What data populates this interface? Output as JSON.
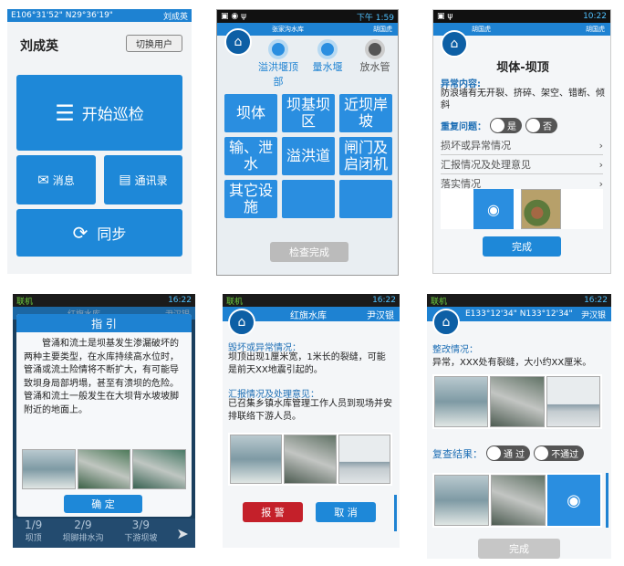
{
  "p1": {
    "status_coords": "E106°31'52\" N29°36'19\"",
    "status_user": "刘成英",
    "user_name": "刘成英",
    "switch_user": "切换用户",
    "start_inspection": "开始巡检",
    "messages": "消息",
    "contacts": "通讯录",
    "sync": "同步"
  },
  "p2": {
    "status_time": "下午 1:59",
    "title": "张家沟水库",
    "user": "胡国虎",
    "tabs": [
      {
        "label": "溢洪堰顶部"
      },
      {
        "label": "量水堰"
      },
      {
        "label": "放水管"
      }
    ],
    "tiles": [
      "坝体",
      "坝基坝区",
      "近坝岸坡",
      "输、泄水",
      "溢洪道",
      "闸门及启闭机",
      "其它设施",
      "",
      ""
    ],
    "check_done": "检查完成"
  },
  "p3": {
    "status_time": "10:22",
    "title": "胡国虎",
    "user": "胡国虎",
    "page_title": "坝体-坝顶",
    "abnormal_label": "异常内容:",
    "abnormal_text": "防浪墙有无开裂、挤碎、架空、错断、倾斜",
    "repeat_label": "重复问题：",
    "yes": "是",
    "no": "否",
    "rows": [
      "损坏或异常情况",
      "汇报情况及处理意见",
      "落实情况"
    ],
    "done": "完成"
  },
  "p4": {
    "status_left": "联机",
    "status_time": "16:22",
    "bg_title": "红旗水库",
    "bg_user": "尹汉银",
    "dialog_title": "指 引",
    "dialog_text": "管涌和流土是坝基发生渗漏破坏的两种主要类型，在水库持续高水位时，管涌或流土险情将不断扩大，有可能导致垻身局部坍塌，甚至有溃坝的危险。管涌和流土一般发生在大坝背水坡坡脚附近的地面上。",
    "confirm": "确 定",
    "bottom": [
      {
        "num": "1/9",
        "label": "坝顶"
      },
      {
        "num": "2/9",
        "label": "坝脚排水沟"
      },
      {
        "num": "3/9",
        "label": "下游坝坡"
      }
    ]
  },
  "p5": {
    "status_left": "联机",
    "status_time": "16:22",
    "title": "红旗水库",
    "user": "尹汉银",
    "damage_label": "毁坏或异常情况：",
    "damage_text": "坝顶出现1厘米宽，1米长的裂缝，可能是前天XX地震引起的。",
    "report_label": "汇报情况及处理意见：",
    "report_text": "已召集乡镇水库管理工作人员到现场并安排联络下游人员。",
    "alarm": "报 警",
    "cancel": "取 消"
  },
  "p6": {
    "status_left": "联机",
    "status_time": "16:22",
    "coords": "E133°12'34\" N133°12'34\"",
    "user": "尹汉银",
    "rect_label": "整改情况：",
    "rect_text": "异常，XXX处有裂缝，大小约XX厘米。",
    "recheck_label": "复查结果：",
    "pass": "通 过",
    "fail": "不通过",
    "done": "完成"
  }
}
